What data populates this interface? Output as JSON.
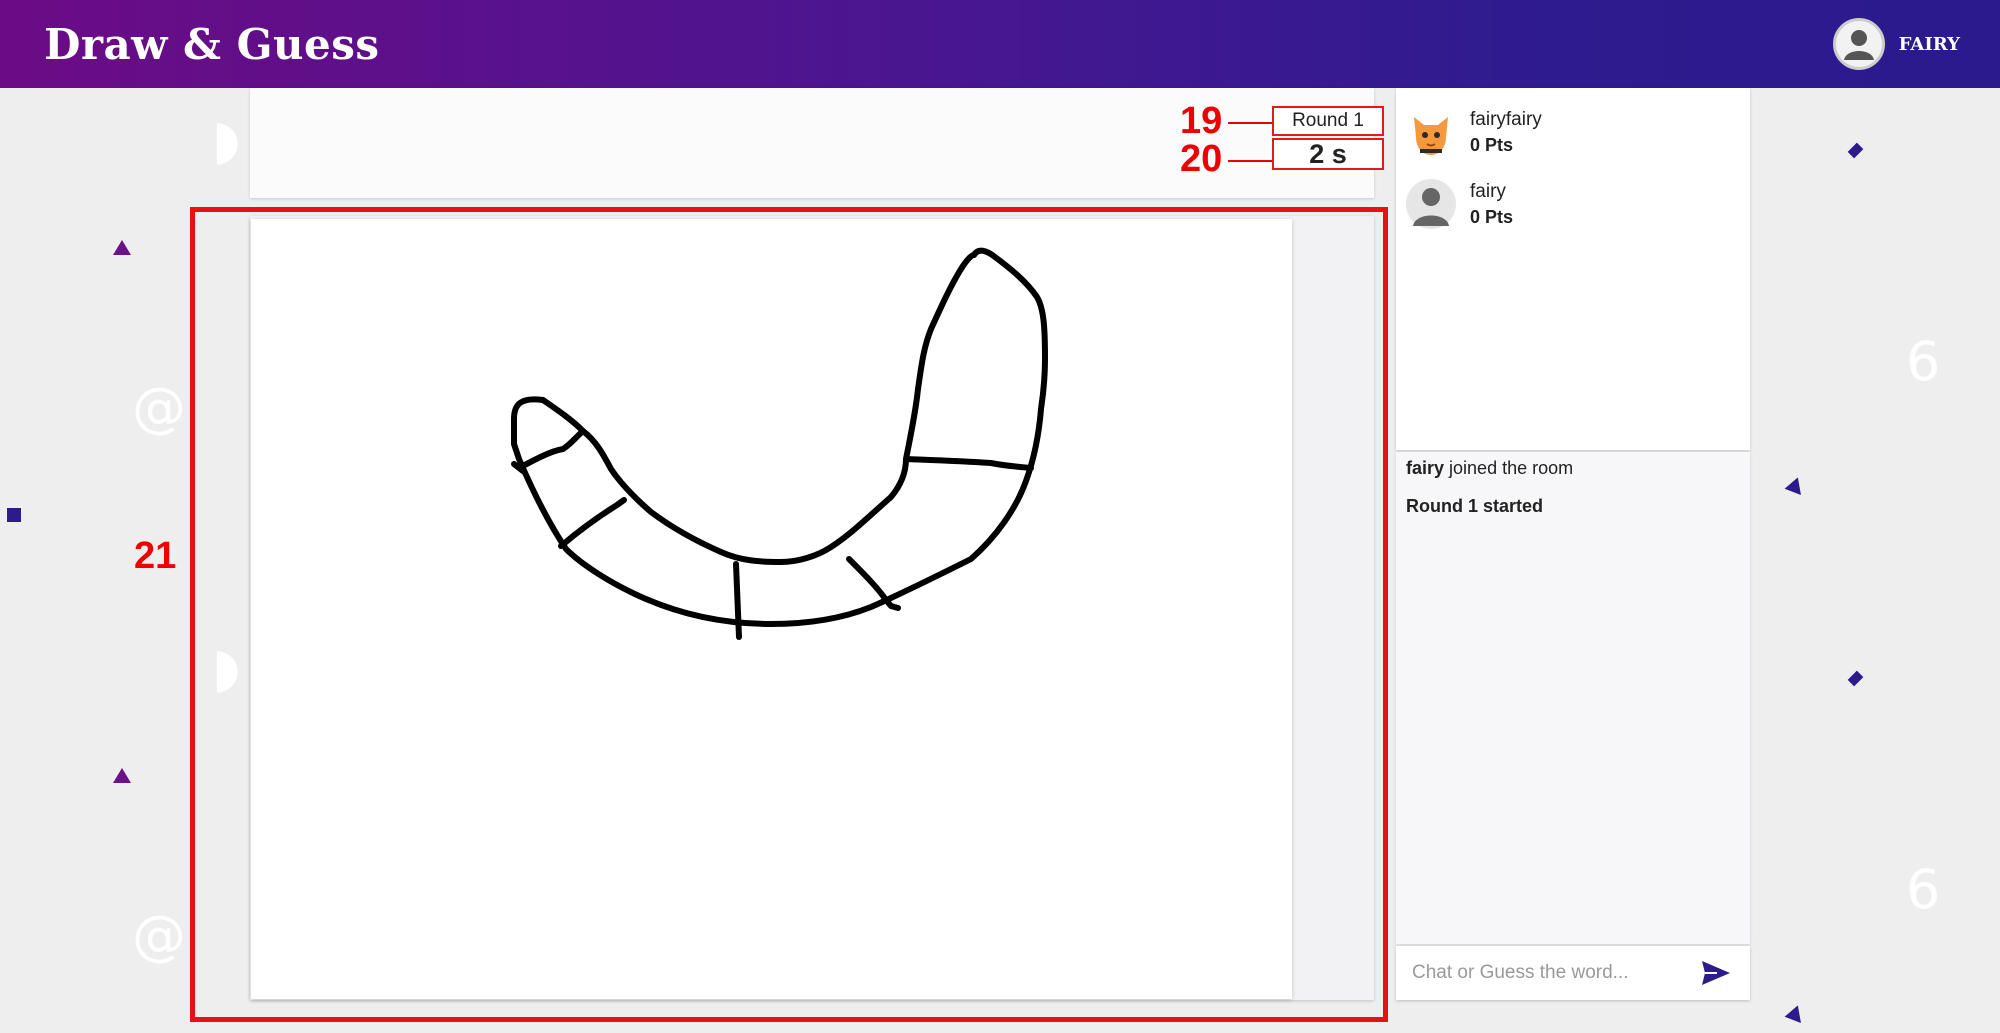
{
  "app": {
    "title": "Draw & Guess"
  },
  "user": {
    "name": "FAIRY",
    "icon": "account-circle-icon"
  },
  "game": {
    "round_label": "Round 1",
    "timer": "2 s"
  },
  "callouts": {
    "round": "19",
    "timer": "20",
    "canvas": "21"
  },
  "players": [
    {
      "name": "fairyfairy",
      "points": "0 Pts",
      "avatar": "orange-cat-avatar"
    },
    {
      "name": "fairy",
      "points": "0 Pts",
      "avatar": "default-user-avatar"
    }
  ],
  "chat": {
    "messages": [
      {
        "bold": "fairy",
        "text": " joined the room"
      },
      {
        "bold": "Round 1 started",
        "text": ""
      }
    ],
    "placeholder": "Chat or Guess the word...",
    "send_icon": "send-icon"
  },
  "colors": {
    "header_start": "#6c0b86",
    "header_end": "#2a1a8d",
    "accent": "#2d1a8c",
    "annotation_red": "#e8110f"
  }
}
